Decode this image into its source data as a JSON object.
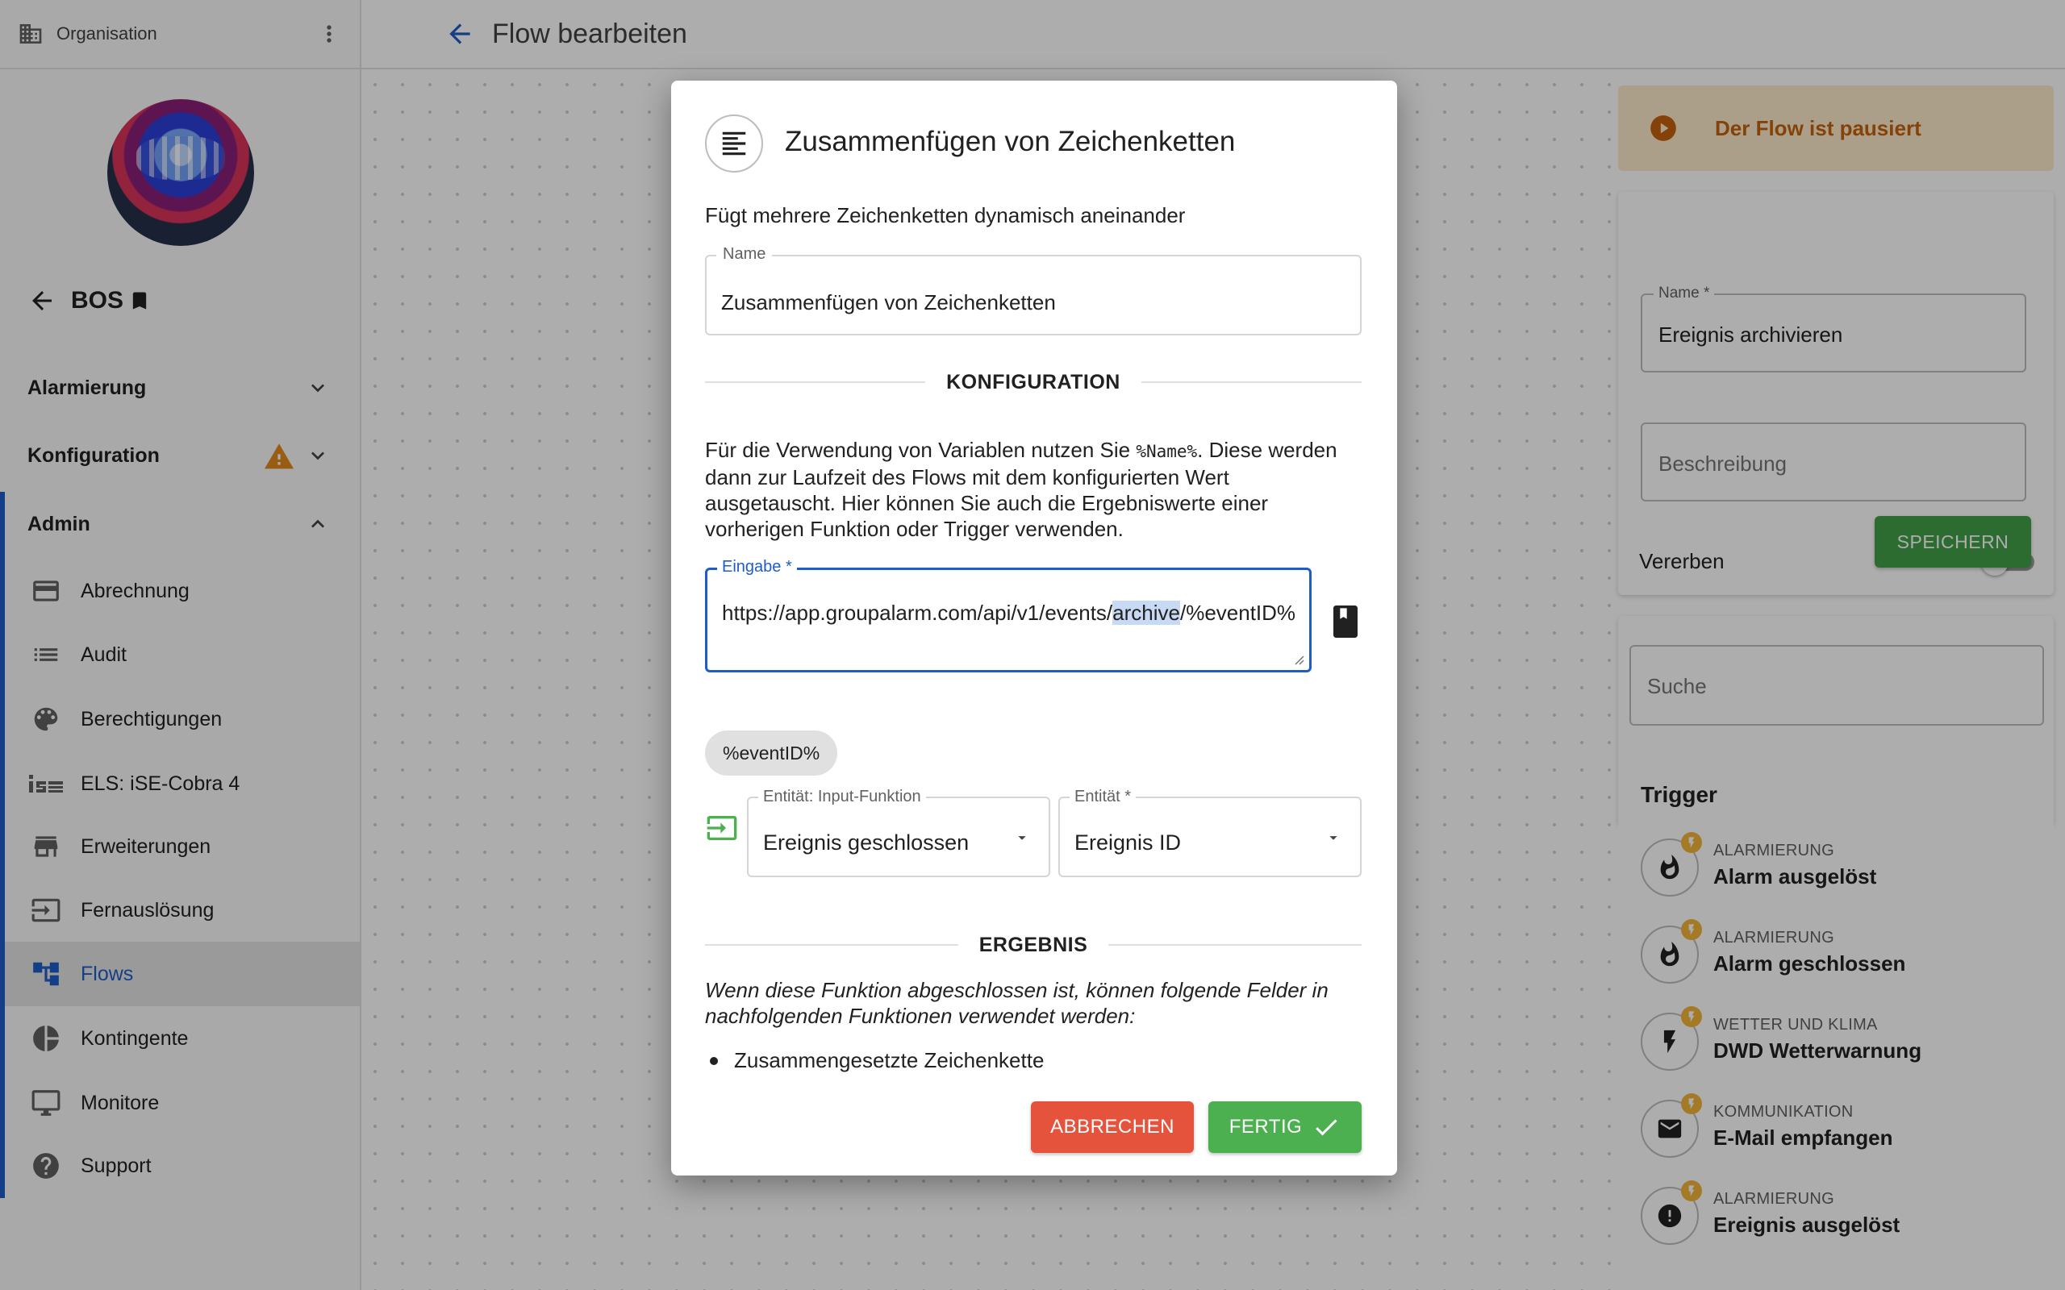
{
  "sidebar": {
    "org_label": "Organisation",
    "back_label": "BOS",
    "sections": [
      {
        "label": "Alarmierung"
      },
      {
        "label": "Konfiguration"
      },
      {
        "label": "Admin"
      }
    ],
    "items": [
      {
        "label": "Abrechnung",
        "icon": "credit-card-icon"
      },
      {
        "label": "Audit",
        "icon": "list-icon"
      },
      {
        "label": "Berechtigungen",
        "icon": "palette-icon"
      },
      {
        "label": "ELS: iSE-Cobra 4",
        "icon": "ise-logo-icon"
      },
      {
        "label": "Erweiterungen",
        "icon": "store-icon"
      },
      {
        "label": "Fernauslösung",
        "icon": "input-arrow-icon"
      },
      {
        "label": "Flows",
        "icon": "flow-icon",
        "active": true
      },
      {
        "label": "Kontingente",
        "icon": "pie-chart-icon"
      },
      {
        "label": "Monitore",
        "icon": "monitor-icon"
      },
      {
        "label": "Support",
        "icon": "help-icon"
      }
    ]
  },
  "header": {
    "title": "Flow bearbeiten"
  },
  "right_panel": {
    "paused_text": "Der Flow ist pausiert",
    "name_label": "Name *",
    "name_value": "Ereignis archivieren",
    "description_placeholder": "Beschreibung",
    "inherit_label": "Vererben",
    "inherit_on": false,
    "save_label": "SPEICHERN",
    "search_placeholder": "Suche",
    "trigger_title": "Trigger",
    "triggers": [
      {
        "category": "ALARMIERUNG",
        "name": "Alarm ausgelöst",
        "icon": "flame-icon"
      },
      {
        "category": "ALARMIERUNG",
        "name": "Alarm geschlossen",
        "icon": "flame-icon"
      },
      {
        "category": "WETTER UND KLIMA",
        "name": "DWD Wetterwarnung",
        "icon": "lightning-icon"
      },
      {
        "category": "KOMMUNIKATION",
        "name": "E-Mail empfangen",
        "icon": "mail-icon"
      },
      {
        "category": "ALARMIERUNG",
        "name": "Ereignis ausgelöst",
        "icon": "alert-circle-icon"
      }
    ]
  },
  "dialog": {
    "title": "Zusammenfügen von Zeichenketten",
    "subtitle": "Fügt mehrere Zeichenketten dynamisch aneinander",
    "name_label": "Name",
    "name_value": "Zusammenfügen von Zeichenketten",
    "config_heading": "KONFIGURATION",
    "info_before": "Für die Verwendung von Variablen nutzen Sie ",
    "info_code": "%Name%",
    "info_after": ". Diese werden dann zur Laufzeit des Flows mit dem konfigurierten Wert ausgetauscht. Hier können Sie auch die Ergebniswerte einer vorherigen Funktion oder Trigger verwenden.",
    "input_label": "Eingabe",
    "input_required": "*",
    "input_text_before": "https://app.groupalarm.com/api/v1/events/",
    "input_text_selected": "archive",
    "input_text_after": "/%eventID%",
    "chip_label": "%eventID%",
    "entity_input_label": "Entität: Input-Funktion",
    "entity_input_value": "Ereignis geschlossen",
    "entity_label": "Entität *",
    "entity_value": "Ereignis ID",
    "result_heading": "ERGEBNIS",
    "result_text": "Wenn diese Funktion abgeschlossen ist, können folgende Felder in nachfolgenden Funktionen verwendet werden:",
    "result_items": [
      "Zusammengesetzte Zeichenkette"
    ],
    "cancel_label": "ABBRECHEN",
    "done_label": "FERTIG"
  },
  "colors": {
    "accent": "#1e5cc8",
    "success": "#4caf50",
    "danger": "#e5533d",
    "warning": "#e0891c"
  }
}
